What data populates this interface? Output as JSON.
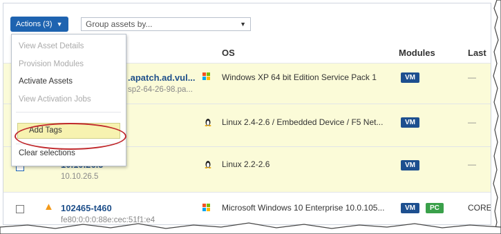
{
  "toolbar": {
    "actions_label": "Actions (3)",
    "group_by_placeholder": "Group assets by..."
  },
  "menu": {
    "items": [
      {
        "label": "View Asset Details",
        "enabled": false
      },
      {
        "label": "Provision Modules",
        "enabled": false
      },
      {
        "label": "Activate Assets",
        "enabled": true
      },
      {
        "label": "View Activation Jobs",
        "enabled": false
      },
      {
        "label": "Add Tags",
        "enabled": true,
        "highlighted": true
      },
      {
        "label": "Clear selections",
        "enabled": true
      }
    ]
  },
  "columns": {
    "os": "OS",
    "modules": "Modules",
    "last": "Last"
  },
  "rows": [
    {
      "name": ".apatch.ad.vul...",
      "sub": "sp2-64-26-98.pa...",
      "os": "Windows XP 64 bit Edition Service Pack 1",
      "os_icon": "windows-icon",
      "modules": [
        "VM"
      ],
      "last": "—",
      "selected": true
    },
    {
      "name": "",
      "sub": "",
      "os": "Linux 2.4-2.6 / Embedded Device / F5 Net...",
      "os_icon": "linux-icon",
      "modules": [
        "VM"
      ],
      "last": "—",
      "selected": true
    },
    {
      "name": "10.10.26.5",
      "sub": "10.10.26.5",
      "os": "Linux 2.2-2.6",
      "os_icon": "linux-icon",
      "modules": [
        "VM"
      ],
      "last": "—",
      "selected": true,
      "checked": true
    },
    {
      "name": "102465-t460",
      "sub": "fe80:0:0:0:88e:cec:51f1:e4",
      "os": "Microsoft Windows 10 Enterprise 10.0.105...",
      "os_icon": "windows-icon",
      "modules": [
        "VM",
        "PC"
      ],
      "last": "CORE",
      "selected": false,
      "checked": false,
      "warning": true
    }
  ],
  "colors": {
    "accent": "#1e63b0",
    "selected_row": "#fbfbd8",
    "highlight_oval": "#c0282c",
    "vm_badge": "#1d4f8f",
    "pc_badge": "#3aa04a"
  }
}
